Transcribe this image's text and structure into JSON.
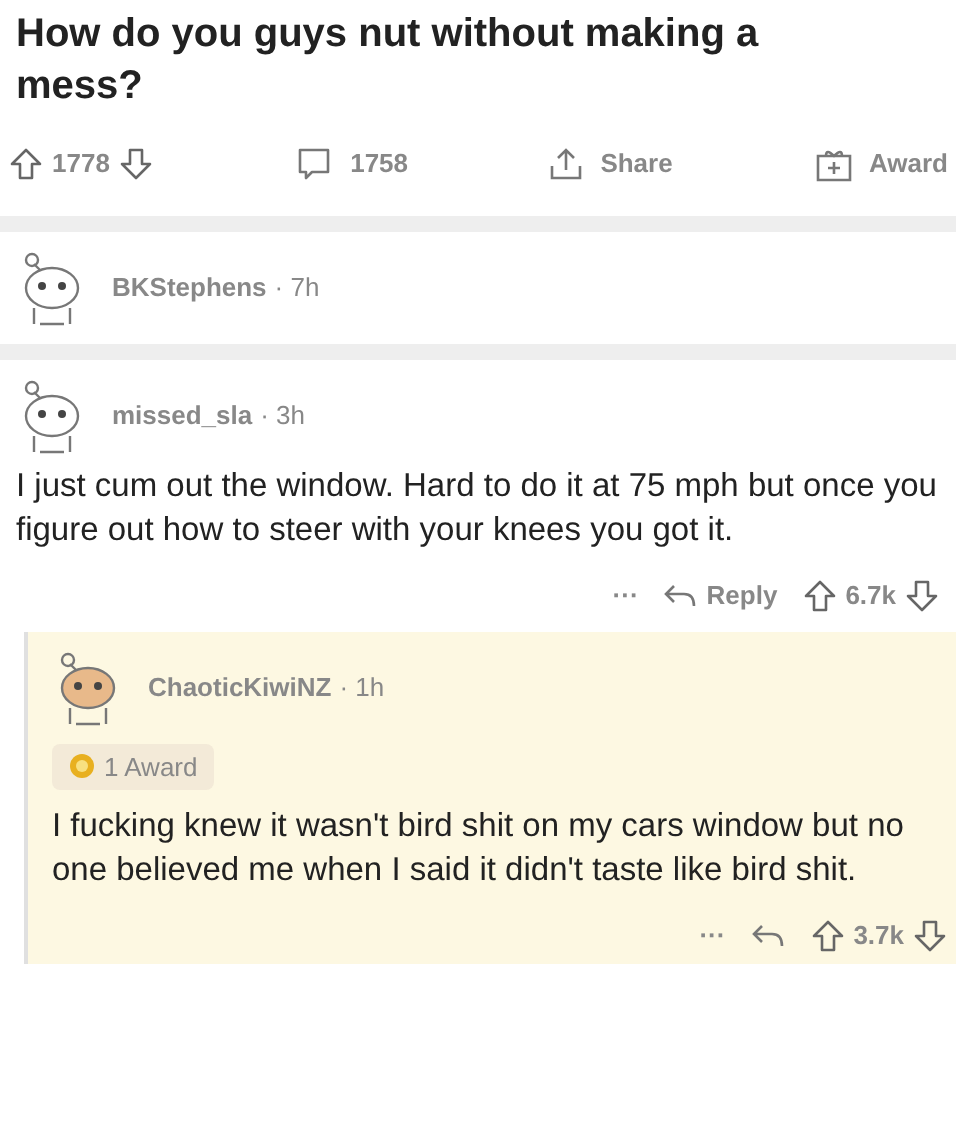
{
  "post": {
    "title": "How do you guys nut without making a mess?",
    "votes": "1778",
    "comments": "1758",
    "share": "Share",
    "award": "Award"
  },
  "comments": [
    {
      "user": "BKStephens",
      "age": "· 7h",
      "highlighted": false
    },
    {
      "user": "missed_sla",
      "age": "· 3h",
      "highlighted": false,
      "body": "I just cum out the window. Hard to do it at 75 mph but once you figure out how to steer with your knees you got it.",
      "more": "···",
      "reply": "Reply",
      "votes": "6.7k",
      "replies": [
        {
          "user": "ChaoticKiwiNZ",
          "age": "· 1h",
          "highlighted": true,
          "award": "1 Award",
          "body": "I fucking knew it wasn't bird shit on my cars window but no one believed me when I said it didn't taste like bird shit.",
          "more": "···",
          "votes": "3.7k"
        }
      ]
    }
  ]
}
